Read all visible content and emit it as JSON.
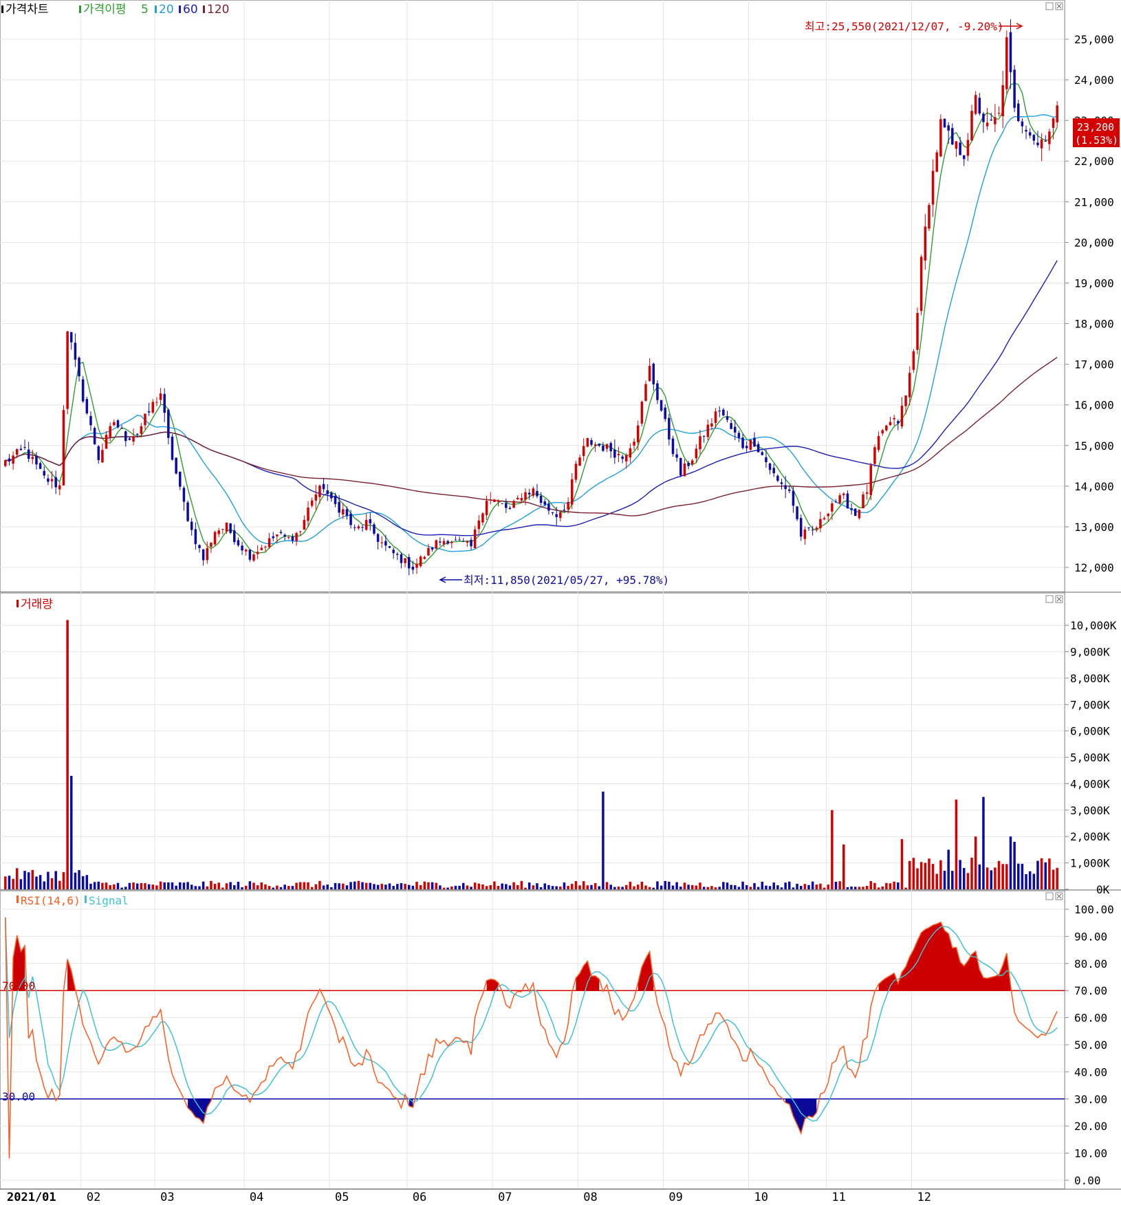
{
  "price_panel": {
    "title": "가격차트",
    "ma_label": "가격이평",
    "ma_periods": [
      {
        "label": "5",
        "color": "#2e9e2e"
      },
      {
        "label": "20",
        "color": "#1f9fdf"
      },
      {
        "label": "60",
        "color": "#1c1cb8"
      },
      {
        "label": "120",
        "color": "#7a2030"
      }
    ],
    "high_label": "최고:25,550(2021/12/07, -9.20%)",
    "low_label": "최저:11,850(2021/05/27, +95.78%)",
    "current_price": "23,200",
    "current_change": "(1.53%)"
  },
  "volume_panel": {
    "title": "거래량"
  },
  "rsi_panel": {
    "title": "RSI(14,6)",
    "signal_label": "Signal",
    "upper_label": "70.00",
    "lower_label": "30.00"
  },
  "colors": {
    "up": "#d40000",
    "down": "#0a0aa8",
    "rsi": "#ff5a1e",
    "signal": "#40c0d8",
    "grid": "#e4e4e4"
  },
  "chart_data": [
    {
      "type": "candlestick",
      "title": "가격차트",
      "ylim": [
        11650,
        25950
      ],
      "y_ticks": [
        "12,000",
        "13,000",
        "14,000",
        "15,000",
        "16,000",
        "17,000",
        "18,000",
        "19,000",
        "20,000",
        "21,000",
        "22,000",
        "23,000",
        "24,000",
        "25,000"
      ],
      "x_ticks": [
        "2021/01",
        "02",
        "03",
        "04",
        "05",
        "06",
        "07",
        "08",
        "09",
        "10",
        "11",
        "12"
      ],
      "close_anchors": [
        [
          0,
          14600
        ],
        [
          5,
          14900
        ],
        [
          10,
          14200
        ],
        [
          14,
          14000
        ],
        [
          16,
          17900
        ],
        [
          18,
          17000
        ],
        [
          21,
          15800
        ],
        [
          24,
          14700
        ],
        [
          28,
          15600
        ],
        [
          31,
          15200
        ],
        [
          34,
          15300
        ],
        [
          38,
          16000
        ],
        [
          40,
          16300
        ],
        [
          42,
          15100
        ],
        [
          45,
          13900
        ],
        [
          48,
          12900
        ],
        [
          51,
          12200
        ],
        [
          54,
          12900
        ],
        [
          57,
          13000
        ],
        [
          60,
          12600
        ],
        [
          63,
          12300
        ],
        [
          66,
          12500
        ],
        [
          70,
          12800
        ],
        [
          73,
          12700
        ],
        [
          76,
          12900
        ],
        [
          79,
          13700
        ],
        [
          82,
          14000
        ],
        [
          84,
          13600
        ],
        [
          87,
          13400
        ],
        [
          90,
          12900
        ],
        [
          93,
          13100
        ],
        [
          96,
          12700
        ],
        [
          99,
          12400
        ],
        [
          102,
          12200
        ],
        [
          105,
          12000
        ],
        [
          108,
          12300
        ],
        [
          111,
          12600
        ],
        [
          114,
          12700
        ],
        [
          117,
          12600
        ],
        [
          120,
          12500
        ],
        [
          122,
          13200
        ],
        [
          124,
          13700
        ],
        [
          127,
          13600
        ],
        [
          130,
          13400
        ],
        [
          133,
          13800
        ],
        [
          136,
          13900
        ],
        [
          139,
          13500
        ],
        [
          142,
          13300
        ],
        [
          145,
          13600
        ],
        [
          147,
          14500
        ],
        [
          150,
          15100
        ],
        [
          153,
          15000
        ],
        [
          156,
          14900
        ],
        [
          159,
          14700
        ],
        [
          162,
          15200
        ],
        [
          164,
          16000
        ],
        [
          166,
          16900
        ],
        [
          168,
          16200
        ],
        [
          171,
          15200
        ],
        [
          174,
          14300
        ],
        [
          177,
          14700
        ],
        [
          180,
          15300
        ],
        [
          184,
          15900
        ],
        [
          187,
          15400
        ],
        [
          190,
          15000
        ],
        [
          193,
          15100
        ],
        [
          196,
          14600
        ],
        [
          199,
          14100
        ],
        [
          202,
          13900
        ],
        [
          205,
          12800
        ],
        [
          208,
          12900
        ],
        [
          210,
          13100
        ],
        [
          213,
          13600
        ],
        [
          216,
          13700
        ],
        [
          219,
          13300
        ],
        [
          222,
          13900
        ],
        [
          224,
          14900
        ],
        [
          227,
          15500
        ],
        [
          230,
          15600
        ],
        [
          232,
          16200
        ],
        [
          234,
          17300
        ],
        [
          236,
          19500
        ],
        [
          238,
          21100
        ],
        [
          241,
          22900
        ],
        [
          244,
          22400
        ],
        [
          247,
          22200
        ],
        [
          250,
          23500
        ],
        [
          253,
          22800
        ],
        [
          256,
          23100
        ],
        [
          258,
          24900
        ],
        [
          260,
          23200
        ],
        [
          263,
          22900
        ],
        [
          266,
          22400
        ],
        [
          269,
          22800
        ],
        [
          271,
          23200
        ]
      ],
      "ma_periods": [
        5,
        20,
        60,
        120
      ]
    },
    {
      "type": "bar",
      "title": "거래량",
      "ylim": [
        0,
        10500
      ],
      "y_ticks": [
        "0K",
        "1,000K",
        "2,000K",
        "3,000K",
        "4,000K",
        "5,000K",
        "6,000K",
        "7,000K",
        "8,000K",
        "9,000K",
        "10,000K"
      ],
      "unit": "K",
      "spikes": [
        [
          16,
          10200
        ],
        [
          17,
          4300
        ],
        [
          154,
          3700
        ],
        [
          213,
          3000
        ],
        [
          216,
          1700
        ],
        [
          231,
          1900
        ],
        [
          241,
          1100
        ],
        [
          243,
          1500
        ],
        [
          245,
          3400
        ],
        [
          250,
          2000
        ],
        [
          252,
          3500
        ],
        [
          259,
          2000
        ],
        [
          260,
          1800
        ]
      ]
    },
    {
      "type": "line",
      "title": "RSI(14,6)",
      "ylim": [
        0,
        100
      ],
      "y_ticks": [
        "0.00",
        "10.00",
        "20.00",
        "30.00",
        "40.00",
        "50.00",
        "60.00",
        "70.00",
        "80.00",
        "90.00",
        "100.00"
      ],
      "series": [
        {
          "name": "RSI(14,6)"
        },
        {
          "name": "Signal"
        }
      ],
      "levels": [
        70,
        30
      ]
    }
  ]
}
